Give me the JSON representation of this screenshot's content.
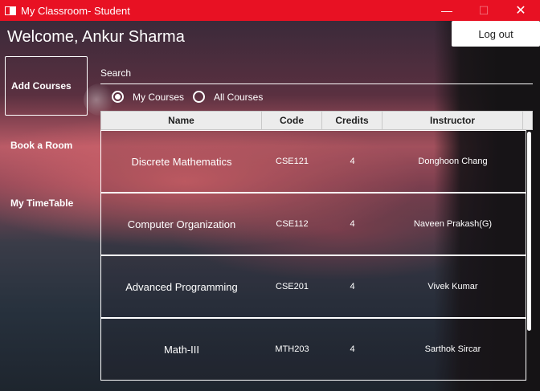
{
  "window": {
    "title": "My Classroom- Student",
    "controls": {
      "minimize": "—",
      "maximize": "☐",
      "close": "✕"
    },
    "accent": "#e81123"
  },
  "header": {
    "welcome": "Welcome, Ankur Sharma",
    "logout_label": "Log out"
  },
  "sidebar": {
    "items": [
      {
        "label": "Add Courses",
        "active": true
      },
      {
        "label": "Book a Room",
        "active": false
      },
      {
        "label": "My TimeTable",
        "active": false
      }
    ]
  },
  "search": {
    "label": "Search",
    "filters": [
      {
        "label": "My Courses",
        "selected": true
      },
      {
        "label": "All Courses",
        "selected": false
      }
    ]
  },
  "table": {
    "columns": [
      "Name",
      "Code",
      "Credits",
      "Instructor"
    ],
    "rows": [
      {
        "name": "Discrete Mathematics",
        "code": "CSE121",
        "credits": "4",
        "instructor": "Donghoon Chang"
      },
      {
        "name": "Computer Organization",
        "code": "CSE112",
        "credits": "4",
        "instructor": "Naveen Prakash(G)"
      },
      {
        "name": "Advanced Programming",
        "code": "CSE201",
        "credits": "4",
        "instructor": "Vivek Kumar"
      },
      {
        "name": "Math-III",
        "code": "MTH203",
        "credits": "4",
        "instructor": "Sarthok Sircar"
      }
    ]
  }
}
